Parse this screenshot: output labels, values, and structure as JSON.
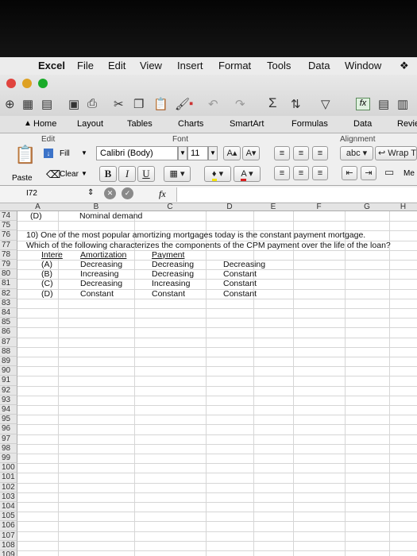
{
  "menubar": {
    "apple_icon": "apple-icon",
    "app": "Excel",
    "items": [
      "File",
      "Edit",
      "View",
      "Insert",
      "Format",
      "Tools",
      "Data",
      "Window"
    ]
  },
  "ribbon_tabs": [
    "Home",
    "Layout",
    "Tables",
    "Charts",
    "SmartArt",
    "Formulas",
    "Data",
    "Revie"
  ],
  "ribbon": {
    "edit_group": "Edit",
    "font_group": "Font",
    "alignment_group": "Alignment",
    "fill": "Fill",
    "clear": "Clear",
    "paste": "Paste",
    "font_name": "Calibri (Body)",
    "font_size": "11",
    "bold": "B",
    "italic": "I",
    "underline": "U",
    "abc": "abc",
    "wrap": "Wrap T",
    "merge": "Me",
    "grow": "A",
    "shrink": "A",
    "font_color": "A"
  },
  "formula_bar": {
    "name_box": "I72",
    "fx": "fx"
  },
  "columns": [
    "A",
    "B",
    "C",
    "D",
    "E",
    "F",
    "G",
    "H"
  ],
  "row_numbers": [
    "74",
    "75",
    "76",
    "77",
    "78",
    "79",
    "80",
    "81",
    "82",
    "83",
    "84",
    "85",
    "86",
    "87",
    "88",
    "89",
    "90",
    "91",
    "92",
    "93",
    "94",
    "95",
    "96",
    "97",
    "98",
    "99",
    "100",
    "101",
    "102",
    "103",
    "104",
    "105",
    "106",
    "107",
    "108",
    "109"
  ],
  "cells": {
    "r74_a": "(D)",
    "r74_b": "Nominal demand",
    "r76": "10) One of the most popular amortizing mortgages today is the constant payment mortgage.",
    "r77": "Which of the following characterizes the components of the CPM payment over the life of the loan?",
    "r78_a": "Intere",
    "r78_b": "Amortization",
    "r78_c": "Payment",
    "r79_a": "(A)",
    "r79_b": "Decreasing",
    "r79_c": "Decreasing",
    "r79_d": "Decreasing",
    "r80_a": "(B)",
    "r80_b": "Increasing",
    "r80_c": "Decreasing",
    "r80_d": "Constant",
    "r81_a": "(C)",
    "r81_b": "Decreasing",
    "r81_c": "Increasing",
    "r81_d": "Constant",
    "r82_a": "(D)",
    "r82_b": "Constant",
    "r82_c": "Constant",
    "r82_d": "Constant"
  }
}
